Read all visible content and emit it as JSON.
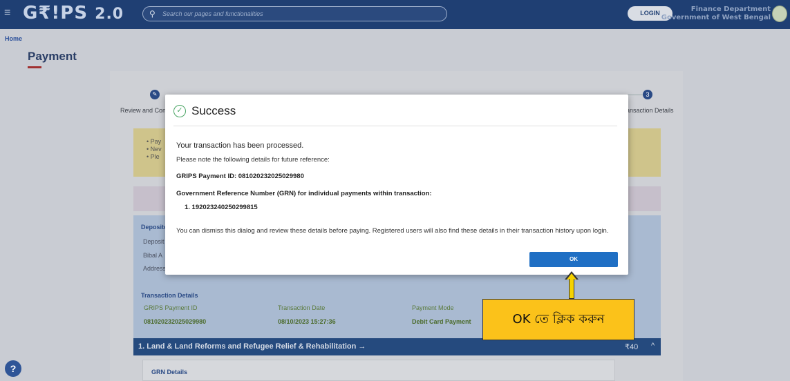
{
  "header": {
    "logo_main": "G₹!PS",
    "logo_version": "2.0",
    "search_placeholder": "Search our pages and functionalities",
    "login_label": "LOGIN",
    "dept_line1": "Finance Department",
    "dept_line2": "Government of West Bengal"
  },
  "page": {
    "breadcrumb": "Home",
    "title": "Payment"
  },
  "stepper": {
    "step1_label": "Review and Confi",
    "step3_number": "3",
    "step3_label": "ansaction Details"
  },
  "background": {
    "bullets": [
      "• Pay",
      "• Nev",
      "• Ple"
    ],
    "depositor_title": "Deposito",
    "depositor_rows": [
      "Deposit",
      "Bibal A",
      "Address"
    ],
    "transaction_title": "Transaction Details",
    "txn_headers": [
      "GRIPS Payment ID",
      "Transaction Date",
      "Payment Mode"
    ],
    "txn_values": [
      "081020232025029980",
      "08/10/2023 15:27:36",
      "Debit Card Payment"
    ],
    "land_title": "1. Land & Land Reforms and Refugee Relief & Rehabilitation →",
    "land_amount": "₹40",
    "grn_details": "GRN Details"
  },
  "modal": {
    "title": "Success",
    "line1": "Your transaction has been processed.",
    "line2": "Please note the following details for future reference:",
    "payment_id": "GRIPS Payment ID: 081020232025029980",
    "grn_heading": "Government Reference Number (GRN) for individual payments within transaction:",
    "grn_item": "1.  192023240250299815",
    "dismiss_text": "You can dismiss this dialog and review these details before paying. Registered users will also find these details in their transaction history upon login.",
    "ok_label": "OK"
  },
  "annotation": {
    "callout_text": "OK তে ক্লিক করুন"
  },
  "colors": {
    "header_bg": "#1f3f73",
    "ok_button": "#1f6fc4",
    "success_green": "#4aa564",
    "callout_bg": "#fbc21a"
  }
}
